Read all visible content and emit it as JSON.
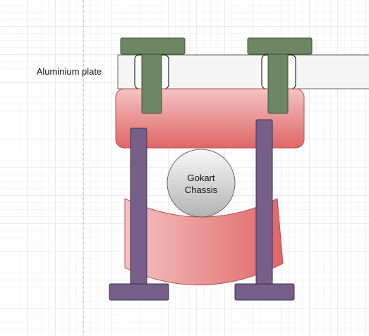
{
  "labels": {
    "plate": "Aluminium plate",
    "chassis_line1": "Gokart",
    "chassis_line2": "Chassis"
  },
  "colors": {
    "plate_fill": "#f5f5f5",
    "plate_stroke": "#666666",
    "clamp_green": "#6d8764",
    "clamp_green_stroke": "#3a5431",
    "red_light": "#f4c3c3",
    "red_dark": "#e06666",
    "red_stroke": "#b85450",
    "bolt_purple": "#76608a",
    "bolt_purple_stroke": "#432d57",
    "circle_light": "#f5f5f5",
    "circle_dark": "#b3b3b3",
    "guide_line": "#bbbbbb"
  }
}
